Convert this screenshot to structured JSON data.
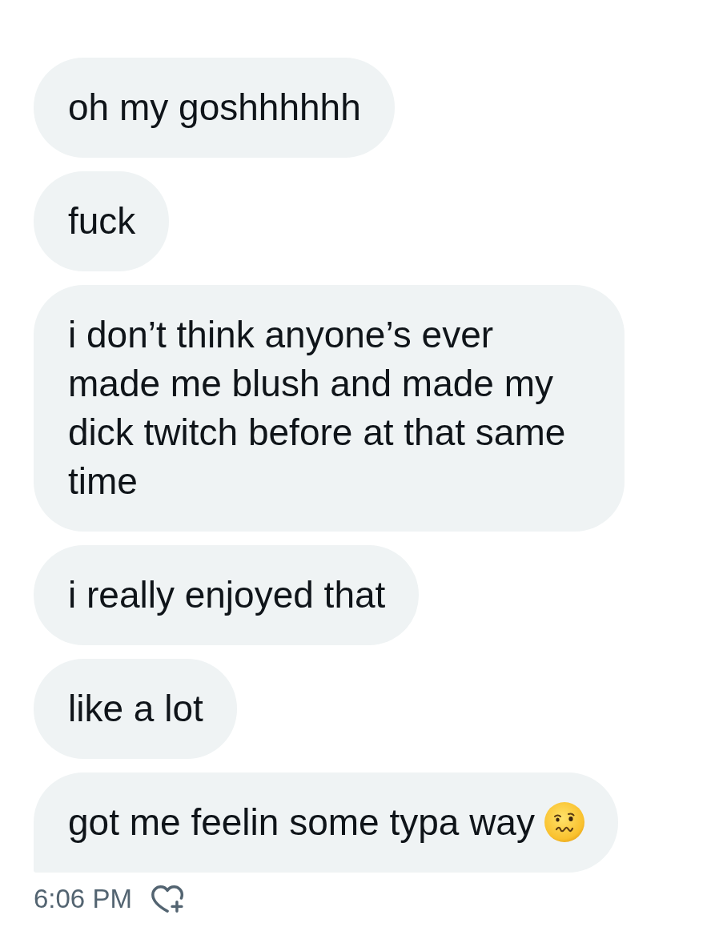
{
  "messages": [
    {
      "text": "oh my goshhhhhh",
      "emoji": false,
      "tail": false
    },
    {
      "text": "fuck",
      "emoji": false,
      "tail": false
    },
    {
      "text": "i don’t think anyone’s ever made me blush and made my dick twitch before at that same time",
      "emoji": false,
      "tail": false
    },
    {
      "text": "i really enjoyed that",
      "emoji": false,
      "tail": false
    },
    {
      "text": "like a lot",
      "emoji": false,
      "tail": false
    },
    {
      "text": "got me feelin some typa way",
      "emoji": true,
      "tail": true
    }
  ],
  "footer": {
    "timestamp": "6:06 PM"
  }
}
